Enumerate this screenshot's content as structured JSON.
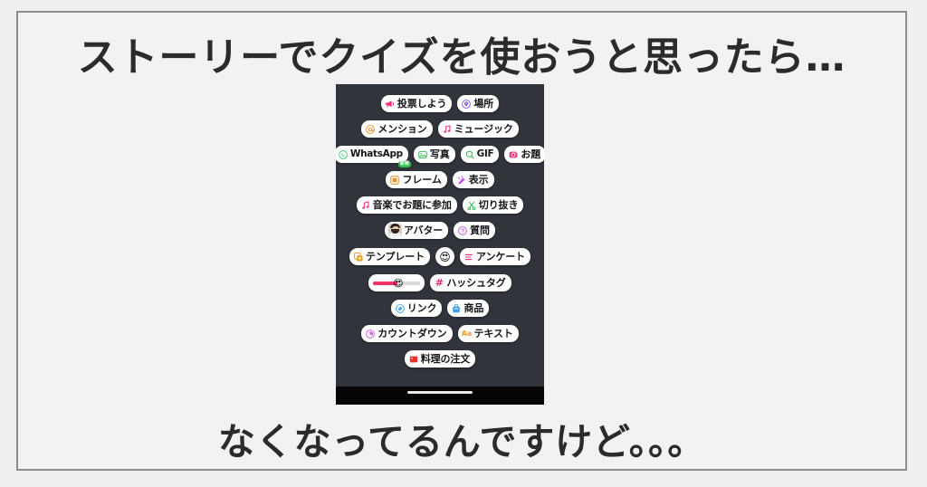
{
  "slide": {
    "caption_top": "ストーリーでクイズを使おうと思ったら…",
    "caption_bottom": "なくなってるんですけど。。。"
  },
  "phone": {
    "background_color": "#31343b",
    "bottom_bar_color": "#050505",
    "sticker_rows": [
      {
        "chips": [
          {
            "label": "投票しよう",
            "icon": "megaphone-icon",
            "icon_color": "#ef2e7b",
            "type": "text"
          },
          {
            "label": "場所",
            "icon": "location-pin-icon",
            "icon_color": "#8b4df0",
            "type": "text"
          }
        ]
      },
      {
        "chips": [
          {
            "label": "メンション",
            "icon": "at-mention-icon",
            "icon_color": "#f08a22",
            "type": "text"
          },
          {
            "label": "ミュージック",
            "icon": "music-note-icon",
            "icon_color": "#ef2e7b",
            "type": "text"
          }
        ]
      },
      {
        "chips": [
          {
            "label": "WhatsApp",
            "icon": "whatsapp-icon",
            "icon_color": "#25d366",
            "type": "text",
            "latin": true,
            "badge": "新規",
            "badge_color": "#2bbd4e"
          },
          {
            "label": "写真",
            "icon": "photo-icon",
            "icon_color": "#2bbd4e",
            "type": "text"
          },
          {
            "label": "GIF",
            "icon": "search-icon",
            "icon_color": "#2bbd4e",
            "type": "text",
            "latin": true
          },
          {
            "label": "お題",
            "icon": "prompt-camera-icon",
            "icon_color": "#ef2e7b",
            "type": "text"
          }
        ]
      },
      {
        "chips": [
          {
            "label": "フレーム",
            "icon": "frame-icon",
            "icon_color": "#f08a22",
            "type": "text"
          },
          {
            "label": "表示",
            "icon": "reveal-icon",
            "icon_color": "#c24df0",
            "type": "text"
          }
        ]
      },
      {
        "chips": [
          {
            "label": "音楽でお題に参加",
            "icon": "music-note-icon",
            "icon_color": "#ef2e7b",
            "type": "text"
          },
          {
            "label": "切り抜き",
            "icon": "scissors-icon",
            "icon_color": "#2bbd4e",
            "type": "text"
          }
        ]
      },
      {
        "chips": [
          {
            "label": "アバター",
            "icon": "avatar-photo-icon",
            "type": "avatar"
          },
          {
            "label": "質問",
            "icon": "question-icon",
            "icon_color": "#d44df0",
            "type": "text"
          }
        ]
      },
      {
        "chips": [
          {
            "label": "テンプレート",
            "icon": "template-icon",
            "icon_color": "#f0a022",
            "type": "text"
          },
          {
            "label": "",
            "icon": "heart-eyes-emoji",
            "type": "emoji-round",
            "emoji": "😍"
          },
          {
            "label": "アンケート",
            "icon": "poll-bars-icon",
            "icon_color": "#ef2e7b",
            "type": "text"
          }
        ]
      },
      {
        "chips": [
          {
            "label": "",
            "icon": "emoji-slider-icon",
            "type": "slider",
            "emoji": "😍",
            "fill_color": "#f0336b",
            "track_color": "#d8d8d8",
            "value_percent": 52
          },
          {
            "label": "ハッシュタグ",
            "icon": "hashtag-icon",
            "icon_color": "#ef2e7b",
            "type": "text",
            "icon_text": "#"
          }
        ]
      },
      {
        "chips": [
          {
            "label": "リンク",
            "icon": "link-icon",
            "icon_color": "#3b9ef0",
            "type": "text"
          },
          {
            "label": "商品",
            "icon": "shopping-bag-icon",
            "icon_color": "#3b9ef0",
            "type": "text"
          }
        ]
      },
      {
        "chips": [
          {
            "label": "カウントダウン",
            "icon": "countdown-clock-icon",
            "icon_color": "#d44df0",
            "type": "text"
          },
          {
            "label": "テキスト",
            "icon": "text-aa-icon",
            "icon_color": "#f0a022",
            "type": "text",
            "icon_text": "Aa"
          }
        ]
      },
      {
        "chips": [
          {
            "label": "料理の注文",
            "icon": "food-order-icon",
            "icon_color": "#ee2d2d",
            "type": "text"
          }
        ]
      }
    ]
  }
}
